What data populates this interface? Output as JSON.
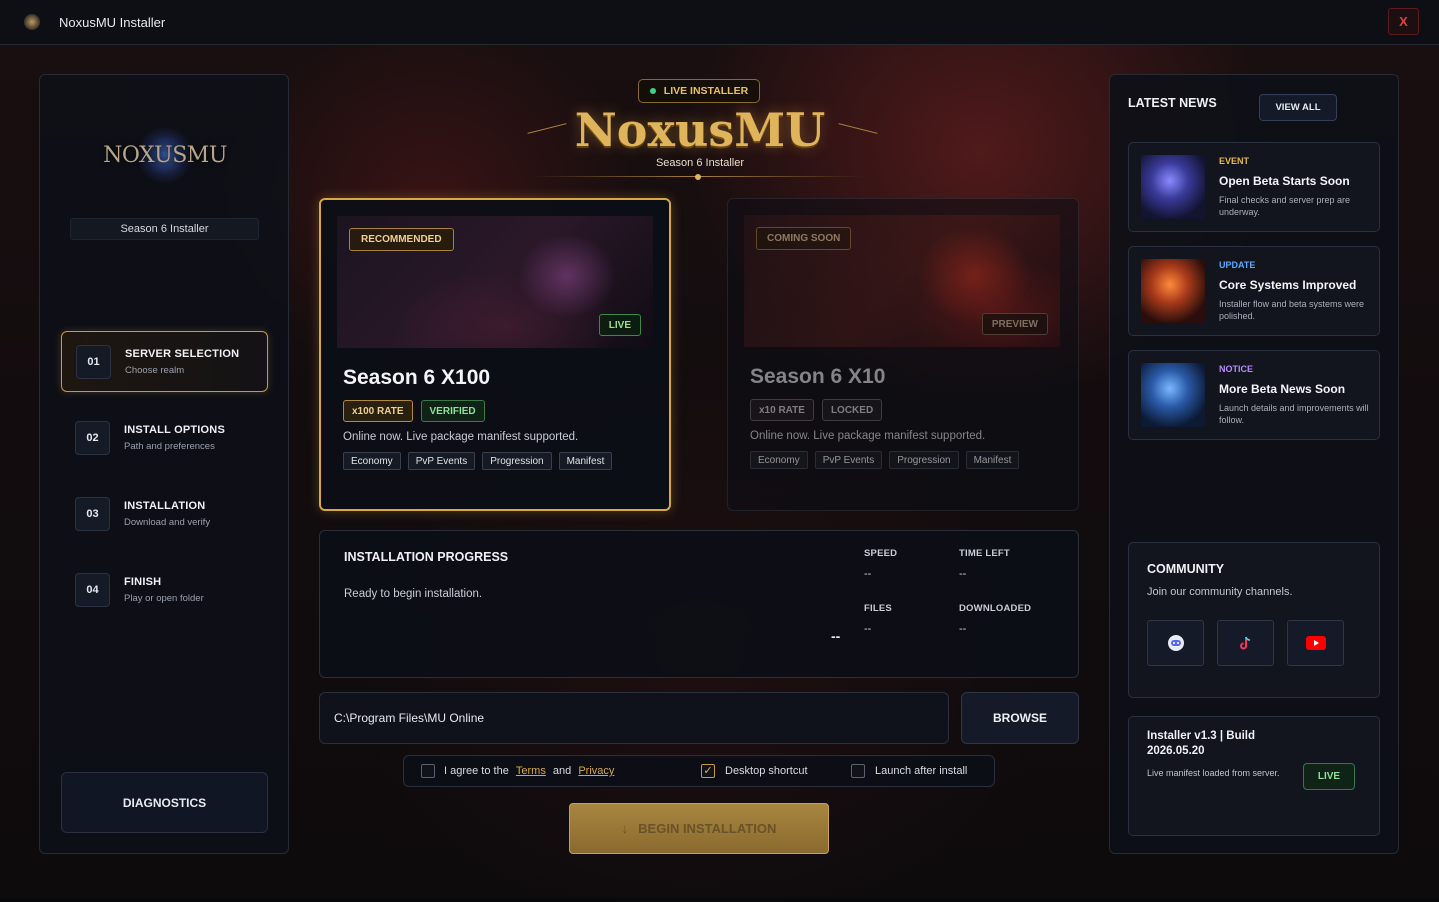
{
  "window": {
    "title": "NoxusMU Installer",
    "close_label": "X"
  },
  "sidebar": {
    "logo_text": "NOXUSMU",
    "season_label": "Season 6 Installer",
    "steps": [
      {
        "num": "01",
        "title": "SERVER SELECTION",
        "sub": "Choose realm",
        "active": true
      },
      {
        "num": "02",
        "title": "INSTALL OPTIONS",
        "sub": "Path and preferences",
        "active": false
      },
      {
        "num": "03",
        "title": "INSTALLATION",
        "sub": "Download and verify",
        "active": false
      },
      {
        "num": "04",
        "title": "FINISH",
        "sub": "Play or open folder",
        "active": false
      }
    ],
    "diagnostics_label": "DIAGNOSTICS"
  },
  "header": {
    "live_badge": "LIVE INSTALLER",
    "brand": "NoxusMU",
    "subtitle": "Season 6 Installer"
  },
  "servers": [
    {
      "corner_tag": "RECOMMENDED",
      "status_tag": "LIVE",
      "title": "Season 6 X100",
      "rate_badge": "x100 RATE",
      "state_badge": "VERIFIED",
      "description": "Online now. Live package manifest supported.",
      "features": [
        "Economy",
        "PvP Events",
        "Progression",
        "Manifest"
      ]
    },
    {
      "corner_tag": "COMING SOON",
      "status_tag": "PREVIEW",
      "title": "Season 6 X10",
      "rate_badge": "x10 RATE",
      "state_badge": "LOCKED",
      "description": "Online now. Live package manifest supported.",
      "features": [
        "Economy",
        "PvP Events",
        "Progression",
        "Manifest"
      ]
    }
  ],
  "progress": {
    "title": "INSTALLATION PROGRESS",
    "status": "Ready to begin installation.",
    "percent": "--",
    "speed_label": "SPEED",
    "speed": "--",
    "time_left_label": "TIME LEFT",
    "time_left": "--",
    "files_label": "FILES",
    "files": "--",
    "downloaded_label": "DOWNLOADED",
    "downloaded": "--"
  },
  "install_path": {
    "value": "C:\\Program Files\\MU Online",
    "browse_label": "BROWSE"
  },
  "options": {
    "agree_prefix": "I agree to the",
    "terms": "Terms",
    "and": "and",
    "privacy": "Privacy",
    "agree_checked": false,
    "desktop_shortcut_label": "Desktop shortcut",
    "desktop_shortcut_checked": true,
    "launch_after_label": "Launch after install",
    "launch_after_checked": false,
    "checkmark": "✓"
  },
  "begin": {
    "label": "BEGIN INSTALLATION",
    "icon": "↓"
  },
  "news": {
    "header": "LATEST NEWS",
    "view_all": "VIEW ALL",
    "items": [
      {
        "category": "EVENT",
        "category_color": "#e8b84a",
        "title": "Open Beta Starts Soon",
        "desc": "Final checks and server prep are underway."
      },
      {
        "category": "UPDATE",
        "category_color": "#5aa8ff",
        "title": "Core Systems Improved",
        "desc": "Installer flow and beta systems were polished."
      },
      {
        "category": "NOTICE",
        "category_color": "#b88aff",
        "title": "More Beta News Soon",
        "desc": "Launch details and improvements will follow."
      }
    ]
  },
  "community": {
    "header": "COMMUNITY",
    "sub": "Join our community channels.",
    "channels": [
      "discord-icon",
      "tiktok-icon",
      "youtube-icon"
    ]
  },
  "version": {
    "title": "Installer v1.3 | Build 2026.05.20",
    "sub": "Live manifest loaded from server.",
    "status": "LIVE"
  }
}
